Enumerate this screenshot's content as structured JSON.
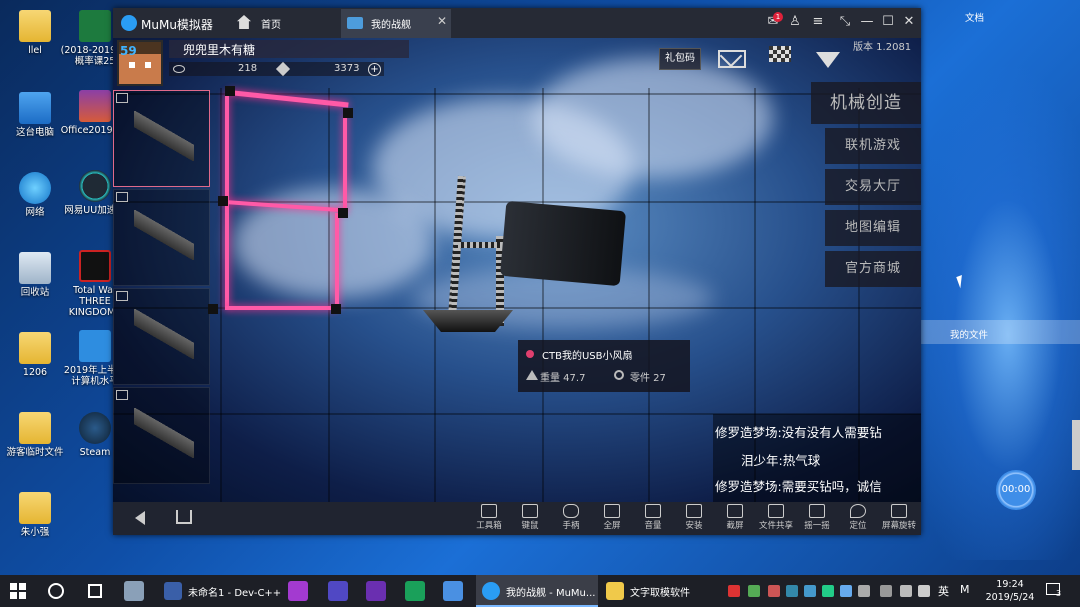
{
  "desktop": {
    "icons": [
      {
        "label": "llel",
        "type": "folder"
      },
      {
        "label": "(2018-2019-2)概率课25",
        "type": "excel"
      },
      {
        "label": "这台电脑",
        "type": "pc"
      },
      {
        "label": "Office2019.zip",
        "type": "winrar"
      },
      {
        "label": "网络",
        "type": "net"
      },
      {
        "label": "网易UU加速器",
        "type": "uu"
      },
      {
        "label": "回收站",
        "type": "bin"
      },
      {
        "label": "Total War THREE KINGDOMS",
        "type": "tw"
      },
      {
        "label": "1206",
        "type": "folder"
      },
      {
        "label": "2019年上半年计算机水平",
        "type": "exam"
      },
      {
        "label": "游客临时文件",
        "type": "folder"
      },
      {
        "label": "Steam",
        "type": "steam"
      },
      {
        "label": "朱小强",
        "type": "folder"
      }
    ],
    "right_labels": {
      "doc": "文档",
      "myfiles": "我的文件"
    },
    "timer": "00:00"
  },
  "emulator": {
    "app_name": "MuMu模拟器",
    "tabs": {
      "home": "首页",
      "game": "我的战舰"
    },
    "notification_count": "1"
  },
  "game": {
    "player": {
      "level": "59",
      "name": "兜兜里木有糖",
      "coins": "218",
      "gems": "3373"
    },
    "gift_code": "礼包码",
    "version": "版本 1.2081",
    "menu": [
      "机械创造",
      "联机游戏",
      "交易大厅",
      "地图编辑",
      "官方商城"
    ],
    "ship": {
      "name": "CTB我的USB小风扇",
      "weight": "重量 47.7",
      "parts": "零件 27"
    },
    "chat": [
      "修罗造梦场:没有没有人需要钻",
      "泪少年:热气球",
      "修罗造梦场:需要买钻吗，诚信"
    ]
  },
  "toolbar": [
    "工具箱",
    "键鼠",
    "手柄",
    "全屏",
    "音量",
    "安装",
    "截屏",
    "文件共享",
    "摇一摇",
    "定位",
    "屏幕旋转"
  ],
  "taskbar": {
    "apps": [
      {
        "label": "未命名1 - Dev-C++"
      },
      {
        "label": "我的战舰 - MuMu..."
      },
      {
        "label": "文字取模软件"
      }
    ],
    "ime": [
      "英",
      "M"
    ],
    "time": "19:24",
    "date": "2019/5/24",
    "notification": "3"
  }
}
